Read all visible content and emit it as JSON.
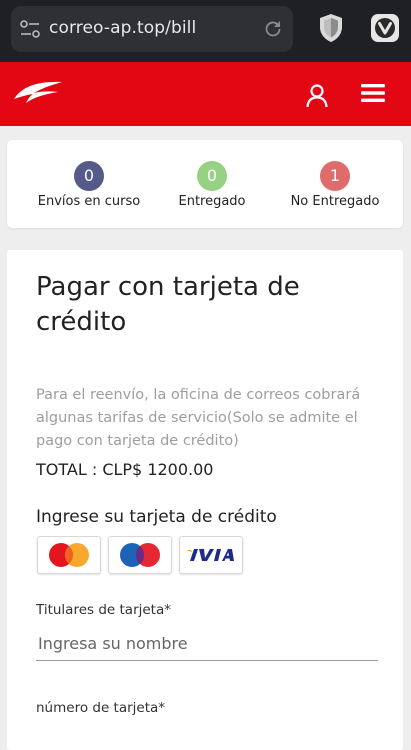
{
  "browser": {
    "url": "correo-ap.top/bill"
  },
  "status": [
    {
      "count": "0",
      "label": "Envíos en curso",
      "color": "#555a8a"
    },
    {
      "count": "0",
      "label": "Entregado",
      "color": "#97d184"
    },
    {
      "count": "1",
      "label": "No Entregado",
      "color": "#e06b6b"
    }
  ],
  "payment": {
    "title": "Pagar con tarjeta de crédito",
    "description": "Para el reenvío, la oficina de correos cobrará algunas tarifas de servicio(Solo se admite el pago con tarjeta de crédito)",
    "total": "TOTAL : CLP$ 1200.00",
    "card_prompt": "Ingrese su tarjeta de crédito",
    "cards": [
      "MasterCard",
      "Maestro",
      "VISA"
    ],
    "fields": {
      "holder_label": "Titulares de tarjeta*",
      "holder_placeholder": "Ingresa su nombre",
      "number_label": "número de tarjeta*"
    }
  },
  "colors": {
    "header_red": "#e30613",
    "browser_bg": "#1f2024"
  }
}
